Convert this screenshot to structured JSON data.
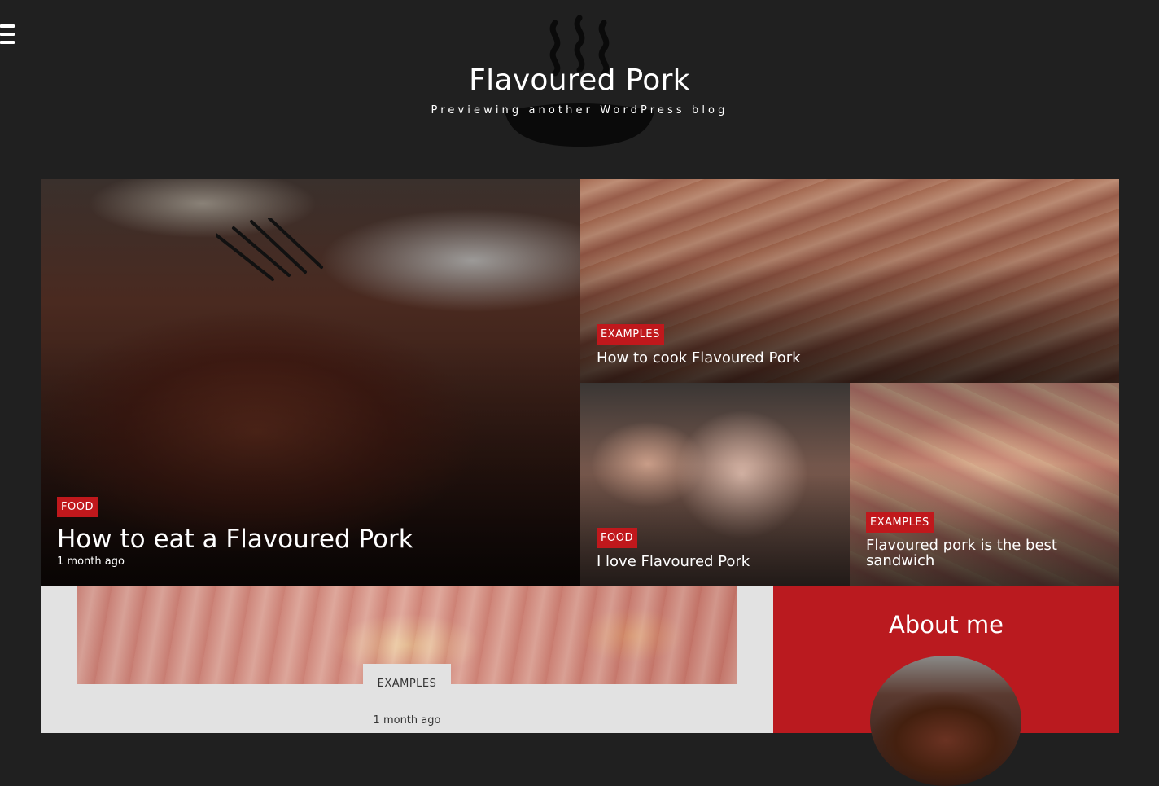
{
  "header": {
    "site_title": "Flavoured Pork",
    "site_description": "Previewing another WordPress blog"
  },
  "featured": [
    {
      "category": "FOOD",
      "title": "How to eat a Flavoured Pork",
      "date": "1 month ago"
    },
    {
      "category": "EXAMPLES",
      "title": "How to cook Flavoured Pork"
    },
    {
      "category": "FOOD",
      "title": "I love Flavoured Pork"
    },
    {
      "category": "EXAMPLES",
      "title": "Flavoured pork is the best sandwich"
    }
  ],
  "post": {
    "category": "EXAMPLES",
    "date": "1 month ago"
  },
  "sidebar": {
    "about_title": "About me"
  },
  "colors": {
    "background": "#202020",
    "accent": "#c0181c",
    "card": "#e2e2e2"
  }
}
